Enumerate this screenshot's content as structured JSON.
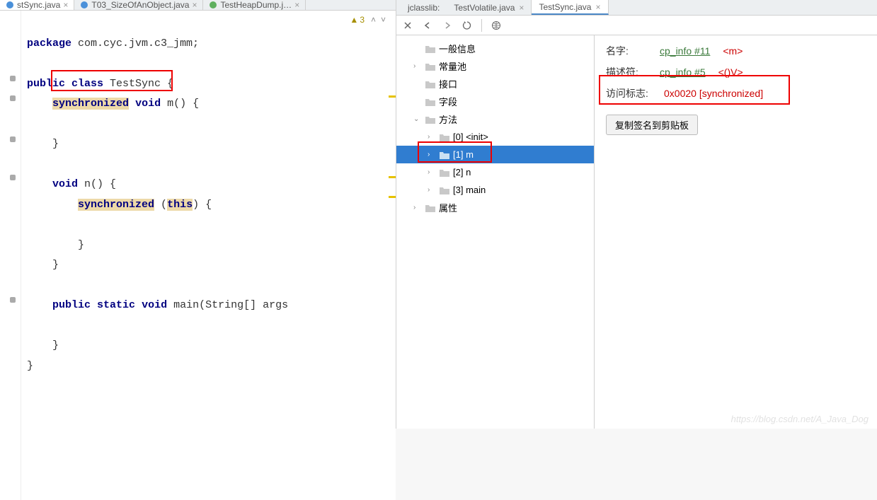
{
  "left_tabs": [
    {
      "label": "stSync.java",
      "icon": "java"
    },
    {
      "label": "T03_SizeOfAnObject.java",
      "icon": "java"
    },
    {
      "label": "TestHeapDump.j…",
      "icon": "class"
    }
  ],
  "warning_count": "3",
  "code": {
    "package_kw": "package",
    "package_name": " com.cyc.jvm.c3_jmm;",
    "public_kw": "public",
    "class_kw": "class",
    "class_name": " TestSync {",
    "sync_kw": "synchronized",
    "void_kw": "void",
    "m_sig": " m() {",
    "close_brace": "}",
    "n_sig": " n() {",
    "this_kw": "this",
    "sync_open": " (",
    "sync_close": ") {",
    "static_kw": "static",
    "main_sig": " main(String[] args"
  },
  "right": {
    "panel_label": "jclasslib:",
    "tabs": [
      "TestVolatile.java",
      "TestSync.java"
    ]
  },
  "tree": {
    "items": [
      {
        "label": "一般信息",
        "indent": 1,
        "arrow": ""
      },
      {
        "label": "常量池",
        "indent": 1,
        "arrow": "›"
      },
      {
        "label": "接口",
        "indent": 1,
        "arrow": ""
      },
      {
        "label": "字段",
        "indent": 1,
        "arrow": ""
      },
      {
        "label": "方法",
        "indent": 1,
        "arrow": "⌄"
      },
      {
        "label": "[0] <init>",
        "indent": 2,
        "arrow": "›"
      },
      {
        "label": "[1] m",
        "indent": 2,
        "arrow": "›",
        "selected": true
      },
      {
        "label": "[2] n",
        "indent": 2,
        "arrow": "›"
      },
      {
        "label": "[3] main",
        "indent": 2,
        "arrow": "›"
      },
      {
        "label": "属性",
        "indent": 1,
        "arrow": "›"
      }
    ]
  },
  "details": {
    "rows": [
      {
        "label": "名字:",
        "link": "cp_info #11",
        "val": "<m>"
      },
      {
        "label": "描述符:",
        "link": "cp_info #5",
        "val": "<()V>"
      },
      {
        "label": "访问标志:",
        "link": "",
        "val": "0x0020 [synchronized]"
      }
    ],
    "copy_button": "复制签名到剪贴板"
  },
  "watermark": "https://blog.csdn.net/A_Java_Dog"
}
